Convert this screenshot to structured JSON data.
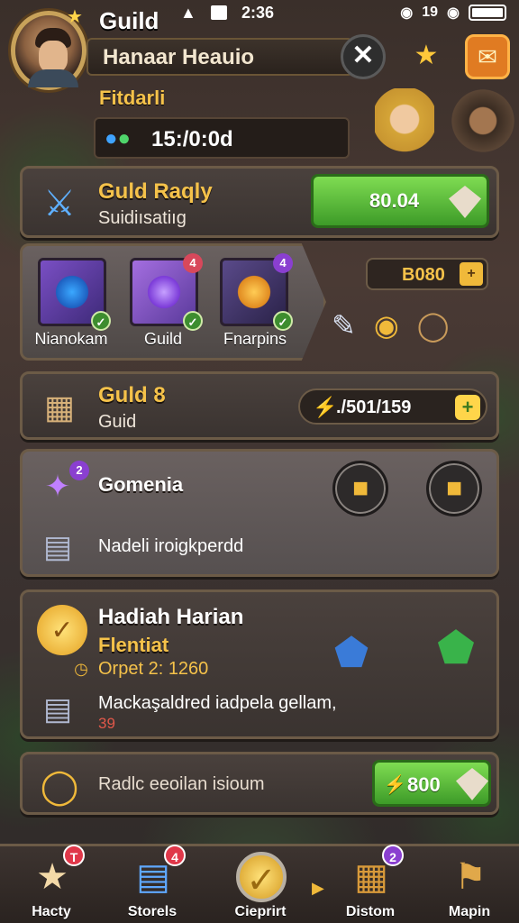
{
  "status": {
    "time": "2:36",
    "signal": "19"
  },
  "header": {
    "title": "Guild",
    "player_name": "Hanaar Heauio",
    "sub_label": "Fitdarli",
    "timer": "15:/0:0d"
  },
  "rally": {
    "title": "Guld Raqly",
    "subtitle": "Suidiısatiıg",
    "button_value": "80.04"
  },
  "items": {
    "cards": [
      {
        "label": "Nianokam",
        "badge": ""
      },
      {
        "label": "Guild",
        "badge": "4"
      },
      {
        "label": "Fnarpins",
        "badge": "4"
      }
    ],
    "price": "B080"
  },
  "guild": {
    "title": "Guld 8",
    "subtitle": "Guid",
    "bar_value": "./501/159"
  },
  "general": {
    "title": "Gomenia",
    "badge": "2",
    "note": "Nadeli iroigkperdd"
  },
  "daily": {
    "title": "Hadiah Harian",
    "sub": "Flentiat",
    "sub2": "Orpet 2: 1260",
    "note": "Mackaşaldred iadpela gellam,",
    "note_count": "39"
  },
  "bottom": {
    "text": "Radlc eeoilan isioum",
    "button_value": "800"
  },
  "nav": [
    {
      "label": "Hacty",
      "badge": "T",
      "icon": "star-icon"
    },
    {
      "label": "Storels",
      "badge": "4",
      "icon": "book-icon"
    },
    {
      "label": "Cieprirt",
      "badge": "",
      "icon": "coin-icon"
    },
    {
      "label": "Distom",
      "badge": "2",
      "icon": "chest-icon"
    },
    {
      "label": "Mapin",
      "badge": "",
      "icon": "map-icon"
    }
  ]
}
